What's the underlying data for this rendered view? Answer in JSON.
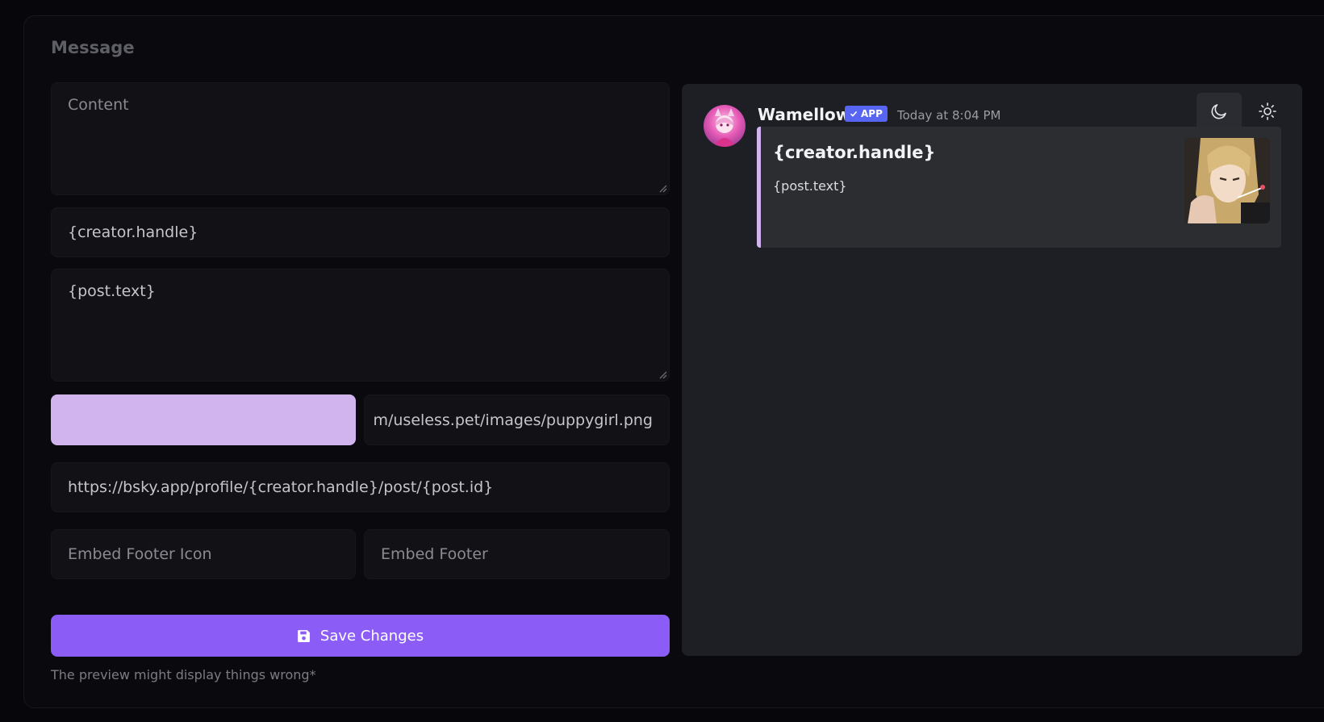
{
  "section": {
    "title": "Message"
  },
  "form": {
    "content": {
      "placeholder": "Content",
      "value": ""
    },
    "embed_title": {
      "value": "{creator.handle}"
    },
    "embed_description": {
      "value": "{post.text}"
    },
    "embed_color": {
      "hex": "#d1b4ee"
    },
    "thumbnail_url": {
      "value": "m/useless.pet/images/puppygirl.png"
    },
    "embed_url": {
      "value": "https://bsky.app/profile/{creator.handle}/post/{post.id}"
    },
    "footer_icon": {
      "placeholder": "Embed Footer Icon"
    },
    "footer_text": {
      "placeholder": "Embed Footer"
    },
    "save_label": "Save Changes",
    "note": "The preview might display things wrong*"
  },
  "preview": {
    "username": "Wamellow",
    "badge": "APP",
    "timestamp": "Today at 8:04 PM",
    "embed": {
      "title": "{creator.handle}",
      "description": "{post.text}",
      "accent": "#d1b4ee"
    },
    "icons": {
      "dark_mode": "moon-icon",
      "light_mode": "sun-icon",
      "save": "floppy-disk-icon",
      "verified": "check-icon"
    }
  },
  "colors": {
    "primary": "#8b5cf6",
    "background": "#07070b",
    "preview_bg": "#1e1f24",
    "embed_bg": "#2b2d31",
    "badge": "#5865f2"
  }
}
